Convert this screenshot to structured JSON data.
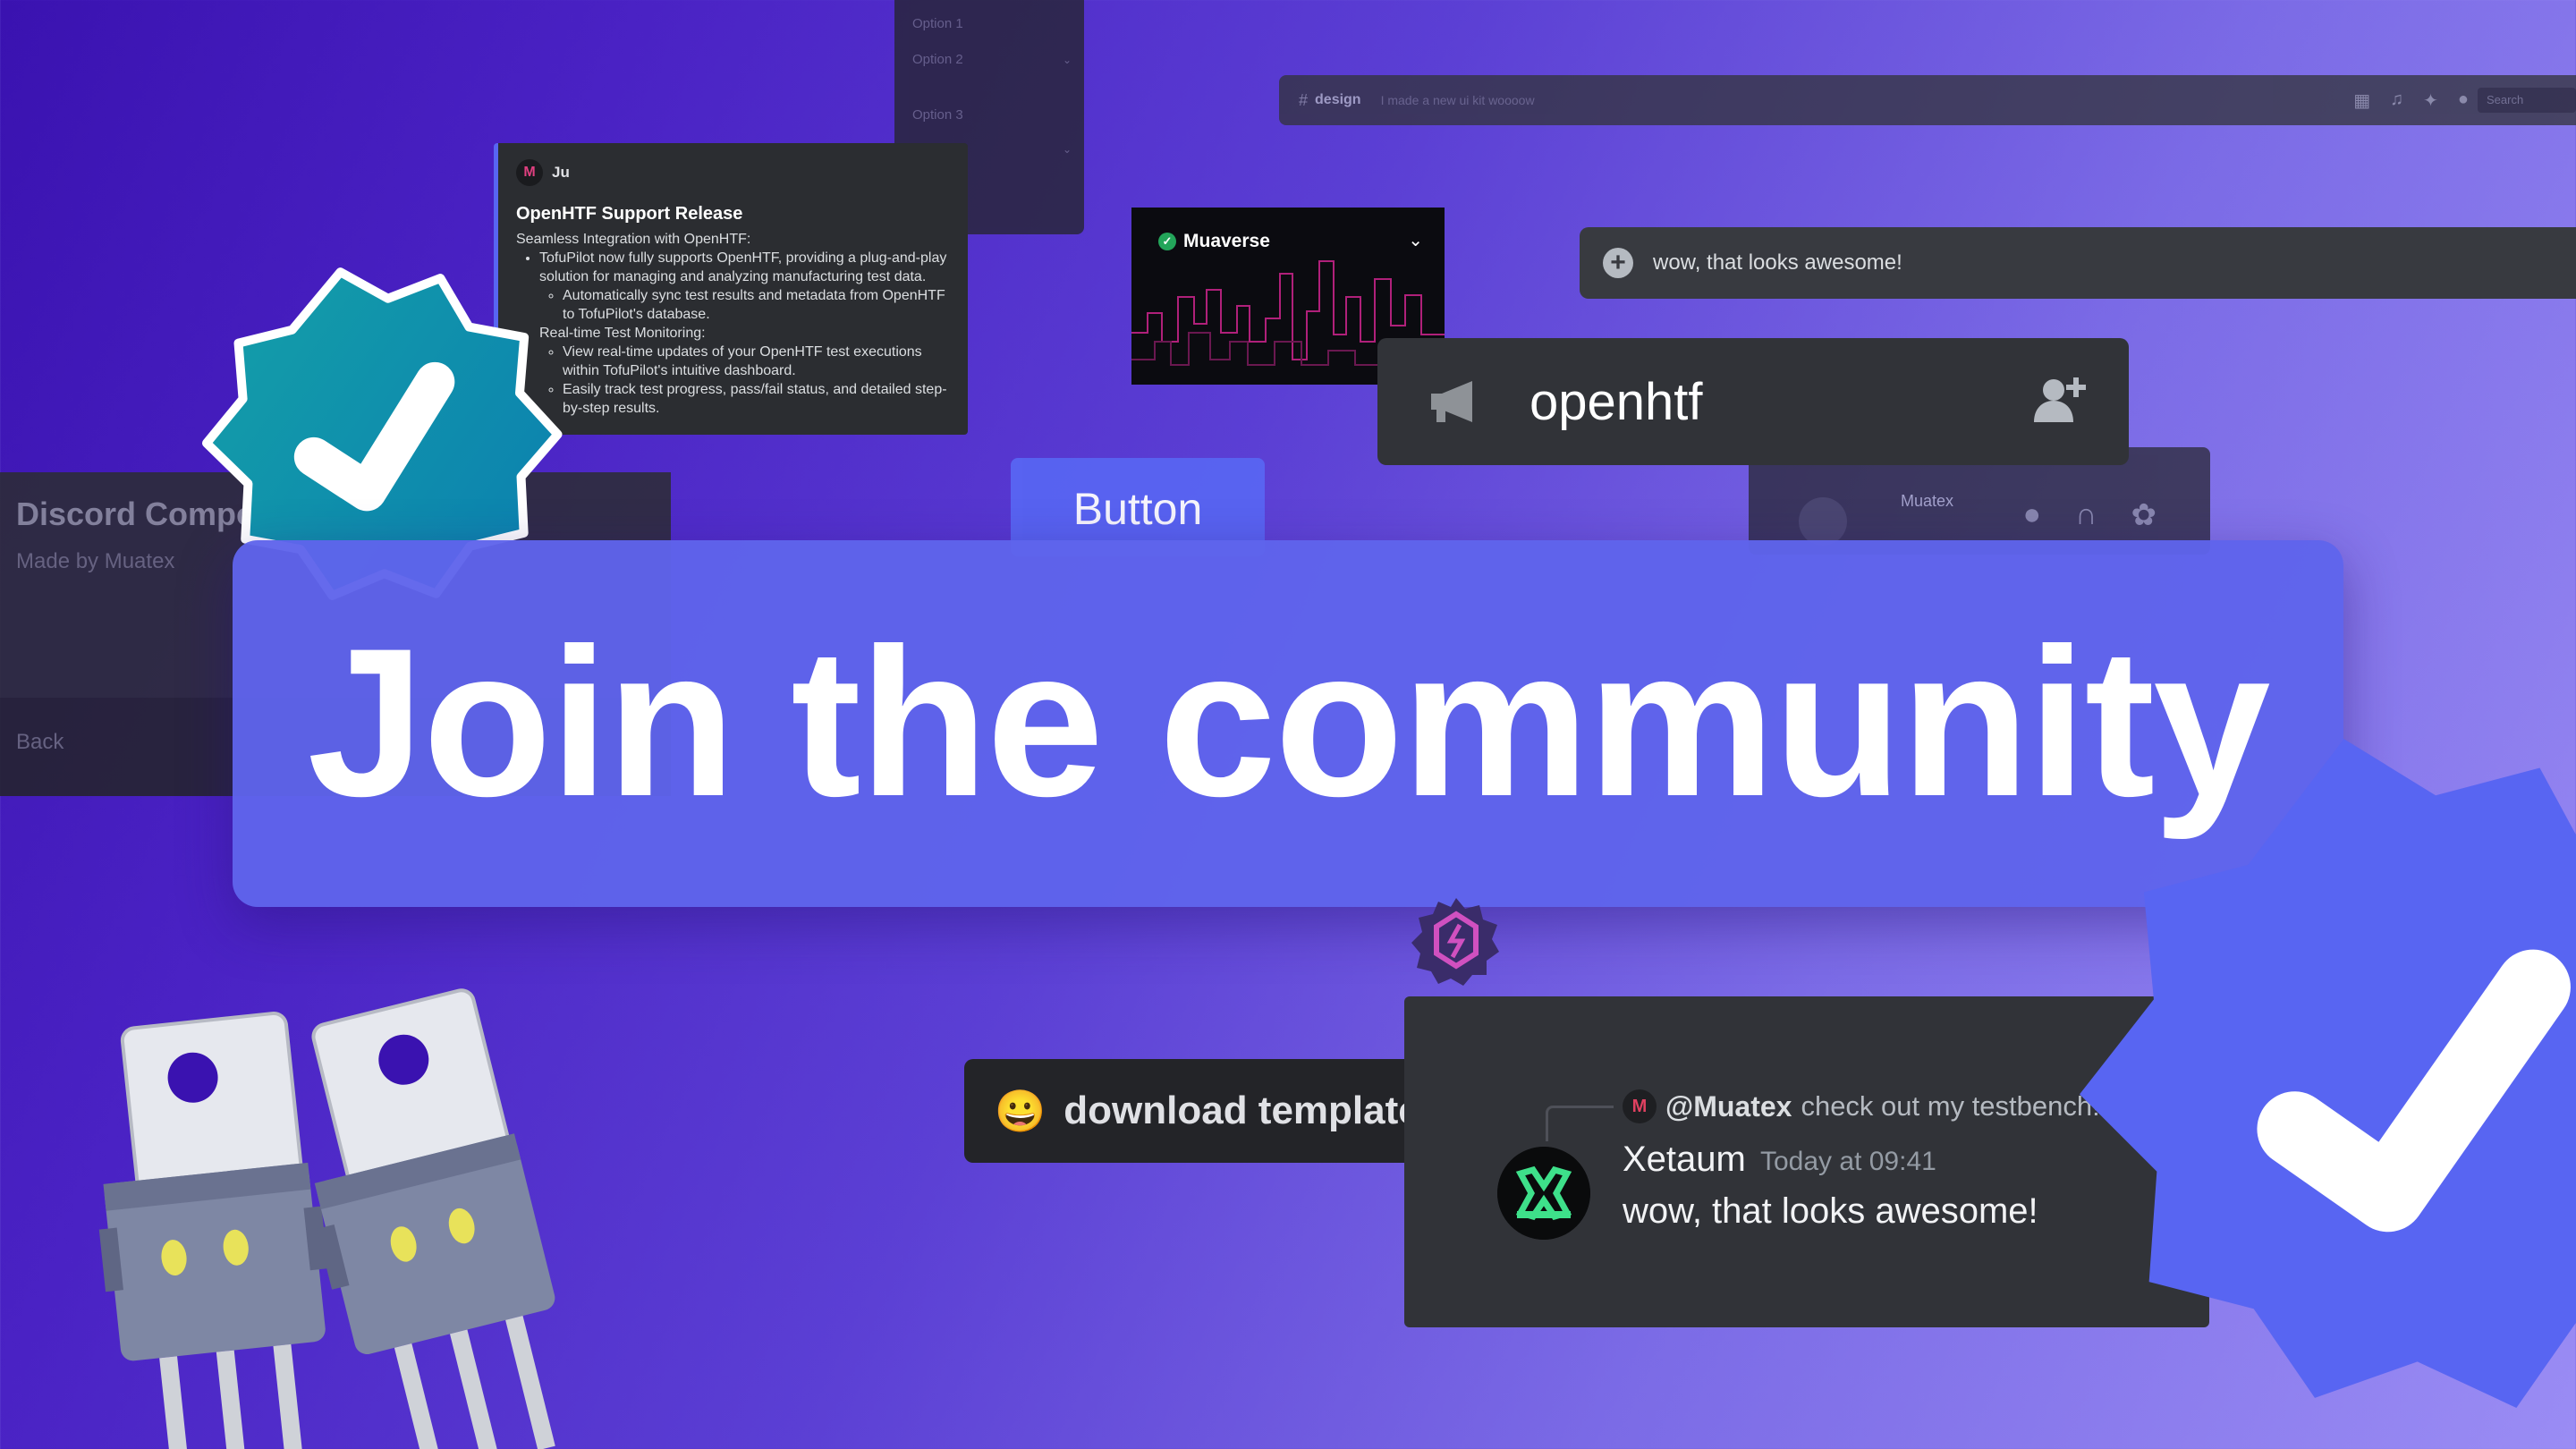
{
  "dropdown_panel": {
    "options": [
      "Option 1",
      "Option 2",
      "Option 3"
    ]
  },
  "channel_bar": {
    "hash": "#",
    "channel": "design",
    "topic": "I made a new ui kit woooow",
    "search_placeholder": "Search"
  },
  "embed": {
    "author": "Ju",
    "title": "OpenHTF Support Release",
    "intro": "Seamless Integration with OpenHTF:",
    "item1": "TofuPilot now fully supports OpenHTF, providing a plug-and-play solution for managing and analyzing manufacturing test data.",
    "item1_sub": "Automatically sync test results and metadata from OpenHTF to TofuPilot's database.",
    "item2": "Real-time Test Monitoring:",
    "item2_sub1": "View real-time updates of your OpenHTF test executions within TofuPilot's intuitive dashboard.",
    "item2_sub2": "Easily track test progress, pass/fail status, and detailed step-by-step results."
  },
  "server_banner": {
    "name": "Muaverse",
    "verified": true,
    "accent": "#b0207a"
  },
  "chat_input": {
    "value": "wow, that looks awesome!"
  },
  "channel_row": {
    "name": "openhtf"
  },
  "voice_panel": {
    "user": "Muatex"
  },
  "button": {
    "label": "Button",
    "color": "#5865f2"
  },
  "component_card": {
    "title": "Discord Components",
    "subtitle": "Made by Muatex",
    "back": "Back"
  },
  "hero": {
    "title": "Join the community",
    "color": "#5f64eb"
  },
  "download_button": {
    "emoji": "😀",
    "label": "download template"
  },
  "message": {
    "reply_user": "@Muatex",
    "reply_text": "check out my testbench!",
    "username": "Xetaum",
    "timestamp": "Today at 09:41",
    "text": "wow, that looks awesome!"
  },
  "icons": {
    "verified_badge_teal": "check-badge-icon",
    "verified_badge_blue": "check-badge-icon",
    "hex": "hex-logo-icon",
    "announcement": "megaphone-icon",
    "add_user": "add-user-icon"
  },
  "colors": {
    "badge_teal": "#0f8fb0",
    "badge_blue": "#5865f2",
    "discord_dark": "#313338"
  }
}
